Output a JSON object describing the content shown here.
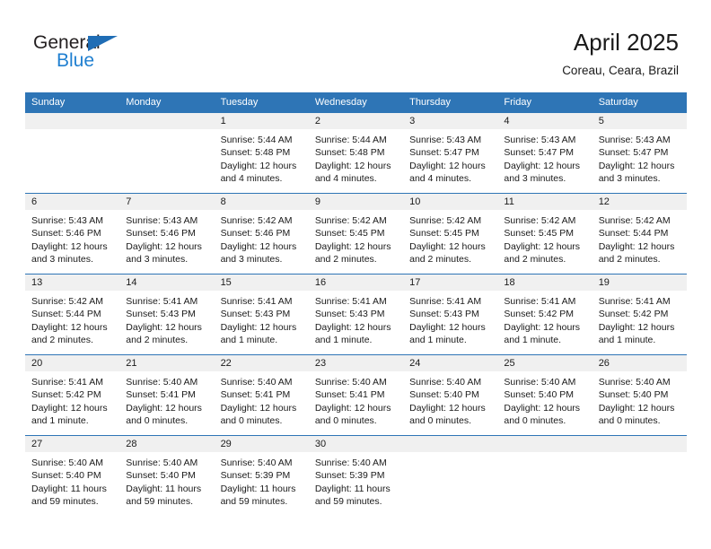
{
  "brand": {
    "name_top": "General",
    "name_bottom": "Blue",
    "flag_color": "#1f6db5",
    "blue_text_color": "#1f7fd0"
  },
  "header": {
    "title": "April 2025",
    "subtitle": "Coreau, Ceara, Brazil"
  },
  "theme": {
    "header_bar_color": "#2e75b6",
    "day_band_color": "#f0f0f0",
    "row_divider_color": "#2e75b6"
  },
  "calendar": {
    "weekday_headers": [
      "Sunday",
      "Monday",
      "Tuesday",
      "Wednesday",
      "Thursday",
      "Friday",
      "Saturday"
    ],
    "weeks": [
      [
        {
          "day": "",
          "sunrise": "",
          "sunset": "",
          "daylight": ""
        },
        {
          "day": "",
          "sunrise": "",
          "sunset": "",
          "daylight": ""
        },
        {
          "day": "1",
          "sunrise": "Sunrise: 5:44 AM",
          "sunset": "Sunset: 5:48 PM",
          "daylight": "Daylight: 12 hours and 4 minutes."
        },
        {
          "day": "2",
          "sunrise": "Sunrise: 5:44 AM",
          "sunset": "Sunset: 5:48 PM",
          "daylight": "Daylight: 12 hours and 4 minutes."
        },
        {
          "day": "3",
          "sunrise": "Sunrise: 5:43 AM",
          "sunset": "Sunset: 5:47 PM",
          "daylight": "Daylight: 12 hours and 4 minutes."
        },
        {
          "day": "4",
          "sunrise": "Sunrise: 5:43 AM",
          "sunset": "Sunset: 5:47 PM",
          "daylight": "Daylight: 12 hours and 3 minutes."
        },
        {
          "day": "5",
          "sunrise": "Sunrise: 5:43 AM",
          "sunset": "Sunset: 5:47 PM",
          "daylight": "Daylight: 12 hours and 3 minutes."
        }
      ],
      [
        {
          "day": "6",
          "sunrise": "Sunrise: 5:43 AM",
          "sunset": "Sunset: 5:46 PM",
          "daylight": "Daylight: 12 hours and 3 minutes."
        },
        {
          "day": "7",
          "sunrise": "Sunrise: 5:43 AM",
          "sunset": "Sunset: 5:46 PM",
          "daylight": "Daylight: 12 hours and 3 minutes."
        },
        {
          "day": "8",
          "sunrise": "Sunrise: 5:42 AM",
          "sunset": "Sunset: 5:46 PM",
          "daylight": "Daylight: 12 hours and 3 minutes."
        },
        {
          "day": "9",
          "sunrise": "Sunrise: 5:42 AM",
          "sunset": "Sunset: 5:45 PM",
          "daylight": "Daylight: 12 hours and 2 minutes."
        },
        {
          "day": "10",
          "sunrise": "Sunrise: 5:42 AM",
          "sunset": "Sunset: 5:45 PM",
          "daylight": "Daylight: 12 hours and 2 minutes."
        },
        {
          "day": "11",
          "sunrise": "Sunrise: 5:42 AM",
          "sunset": "Sunset: 5:45 PM",
          "daylight": "Daylight: 12 hours and 2 minutes."
        },
        {
          "day": "12",
          "sunrise": "Sunrise: 5:42 AM",
          "sunset": "Sunset: 5:44 PM",
          "daylight": "Daylight: 12 hours and 2 minutes."
        }
      ],
      [
        {
          "day": "13",
          "sunrise": "Sunrise: 5:42 AM",
          "sunset": "Sunset: 5:44 PM",
          "daylight": "Daylight: 12 hours and 2 minutes."
        },
        {
          "day": "14",
          "sunrise": "Sunrise: 5:41 AM",
          "sunset": "Sunset: 5:43 PM",
          "daylight": "Daylight: 12 hours and 2 minutes."
        },
        {
          "day": "15",
          "sunrise": "Sunrise: 5:41 AM",
          "sunset": "Sunset: 5:43 PM",
          "daylight": "Daylight: 12 hours and 1 minute."
        },
        {
          "day": "16",
          "sunrise": "Sunrise: 5:41 AM",
          "sunset": "Sunset: 5:43 PM",
          "daylight": "Daylight: 12 hours and 1 minute."
        },
        {
          "day": "17",
          "sunrise": "Sunrise: 5:41 AM",
          "sunset": "Sunset: 5:43 PM",
          "daylight": "Daylight: 12 hours and 1 minute."
        },
        {
          "day": "18",
          "sunrise": "Sunrise: 5:41 AM",
          "sunset": "Sunset: 5:42 PM",
          "daylight": "Daylight: 12 hours and 1 minute."
        },
        {
          "day": "19",
          "sunrise": "Sunrise: 5:41 AM",
          "sunset": "Sunset: 5:42 PM",
          "daylight": "Daylight: 12 hours and 1 minute."
        }
      ],
      [
        {
          "day": "20",
          "sunrise": "Sunrise: 5:41 AM",
          "sunset": "Sunset: 5:42 PM",
          "daylight": "Daylight: 12 hours and 1 minute."
        },
        {
          "day": "21",
          "sunrise": "Sunrise: 5:40 AM",
          "sunset": "Sunset: 5:41 PM",
          "daylight": "Daylight: 12 hours and 0 minutes."
        },
        {
          "day": "22",
          "sunrise": "Sunrise: 5:40 AM",
          "sunset": "Sunset: 5:41 PM",
          "daylight": "Daylight: 12 hours and 0 minutes."
        },
        {
          "day": "23",
          "sunrise": "Sunrise: 5:40 AM",
          "sunset": "Sunset: 5:41 PM",
          "daylight": "Daylight: 12 hours and 0 minutes."
        },
        {
          "day": "24",
          "sunrise": "Sunrise: 5:40 AM",
          "sunset": "Sunset: 5:40 PM",
          "daylight": "Daylight: 12 hours and 0 minutes."
        },
        {
          "day": "25",
          "sunrise": "Sunrise: 5:40 AM",
          "sunset": "Sunset: 5:40 PM",
          "daylight": "Daylight: 12 hours and 0 minutes."
        },
        {
          "day": "26",
          "sunrise": "Sunrise: 5:40 AM",
          "sunset": "Sunset: 5:40 PM",
          "daylight": "Daylight: 12 hours and 0 minutes."
        }
      ],
      [
        {
          "day": "27",
          "sunrise": "Sunrise: 5:40 AM",
          "sunset": "Sunset: 5:40 PM",
          "daylight": "Daylight: 11 hours and 59 minutes."
        },
        {
          "day": "28",
          "sunrise": "Sunrise: 5:40 AM",
          "sunset": "Sunset: 5:40 PM",
          "daylight": "Daylight: 11 hours and 59 minutes."
        },
        {
          "day": "29",
          "sunrise": "Sunrise: 5:40 AM",
          "sunset": "Sunset: 5:39 PM",
          "daylight": "Daylight: 11 hours and 59 minutes."
        },
        {
          "day": "30",
          "sunrise": "Sunrise: 5:40 AM",
          "sunset": "Sunset: 5:39 PM",
          "daylight": "Daylight: 11 hours and 59 minutes."
        },
        {
          "day": "",
          "sunrise": "",
          "sunset": "",
          "daylight": ""
        },
        {
          "day": "",
          "sunrise": "",
          "sunset": "",
          "daylight": ""
        },
        {
          "day": "",
          "sunrise": "",
          "sunset": "",
          "daylight": ""
        }
      ]
    ]
  }
}
